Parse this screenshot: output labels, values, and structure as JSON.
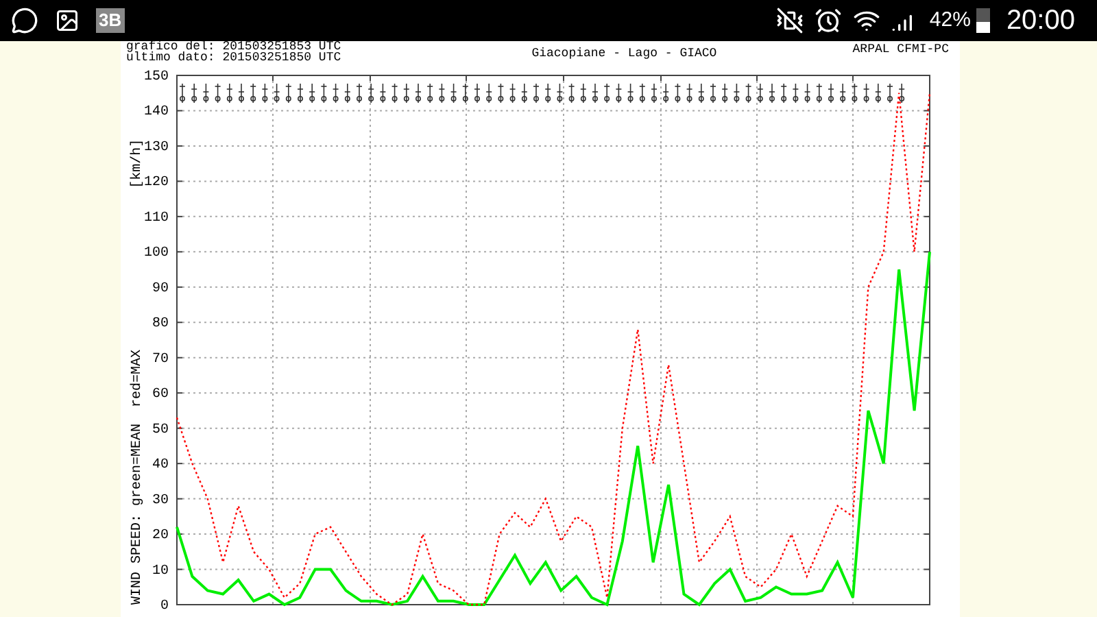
{
  "status_bar": {
    "app_badge": "3B",
    "battery_text": "42%",
    "battery": {
      "level": 0.42
    },
    "time": "20:00"
  },
  "chart_panel": {
    "generated": "grafico del: 201503251853 UTC",
    "last_data": "ultimo dato: 201503251850 UTC",
    "source": "ARPAL CFMI-PC",
    "legend": "WIND SPEED: green=MEAN  red=MAX",
    "chart_data": {
      "type": "line",
      "title": "Giacopiane - Lago - GIACO",
      "ylabel": "[km/h]",
      "categories": [
        null,
        null,
        null,
        null,
        null,
        null,
        null,
        null,
        null,
        null,
        null,
        null,
        null,
        null,
        null,
        null,
        null,
        null,
        null,
        null,
        null,
        null,
        null,
        null,
        null,
        null,
        null,
        null,
        null,
        null,
        null,
        null,
        null,
        null,
        null,
        null,
        null,
        null,
        null,
        null,
        null,
        null,
        null,
        null,
        null,
        null,
        null,
        null,
        null,
        null
      ],
      "series": [
        {
          "color": "#00ee00",
          "line_style": "solid",
          "values": [
            22,
            8,
            4,
            3,
            7,
            1,
            3,
            0,
            2,
            10,
            10,
            4,
            1,
            1,
            0,
            1,
            8,
            1,
            1,
            0,
            0,
            7,
            14,
            6,
            12,
            4,
            8,
            2,
            0,
            18,
            45,
            12,
            34,
            3,
            0,
            6,
            10,
            1,
            2,
            5,
            3,
            3,
            4,
            12,
            2,
            55,
            40,
            95,
            55,
            100
          ]
        },
        {
          "color": "#ff0000",
          "line_style": "dotted",
          "values": [
            53,
            40,
            30,
            12,
            28,
            15,
            10,
            2,
            6,
            20,
            22,
            15,
            8,
            3,
            0,
            3,
            20,
            6,
            4,
            0,
            0,
            20,
            26,
            22,
            30,
            18,
            25,
            22,
            2,
            50,
            78,
            40,
            68,
            40,
            12,
            18,
            25,
            8,
            5,
            10,
            20,
            8,
            18,
            28,
            25,
            90,
            100,
            145,
            100,
            145
          ]
        }
      ],
      "ylim": [
        0,
        150
      ],
      "grid": true,
      "yticks": [
        0,
        10,
        20,
        30,
        40,
        50,
        60,
        70,
        80,
        90,
        100,
        110,
        120,
        130,
        140,
        150
      ]
    }
  }
}
